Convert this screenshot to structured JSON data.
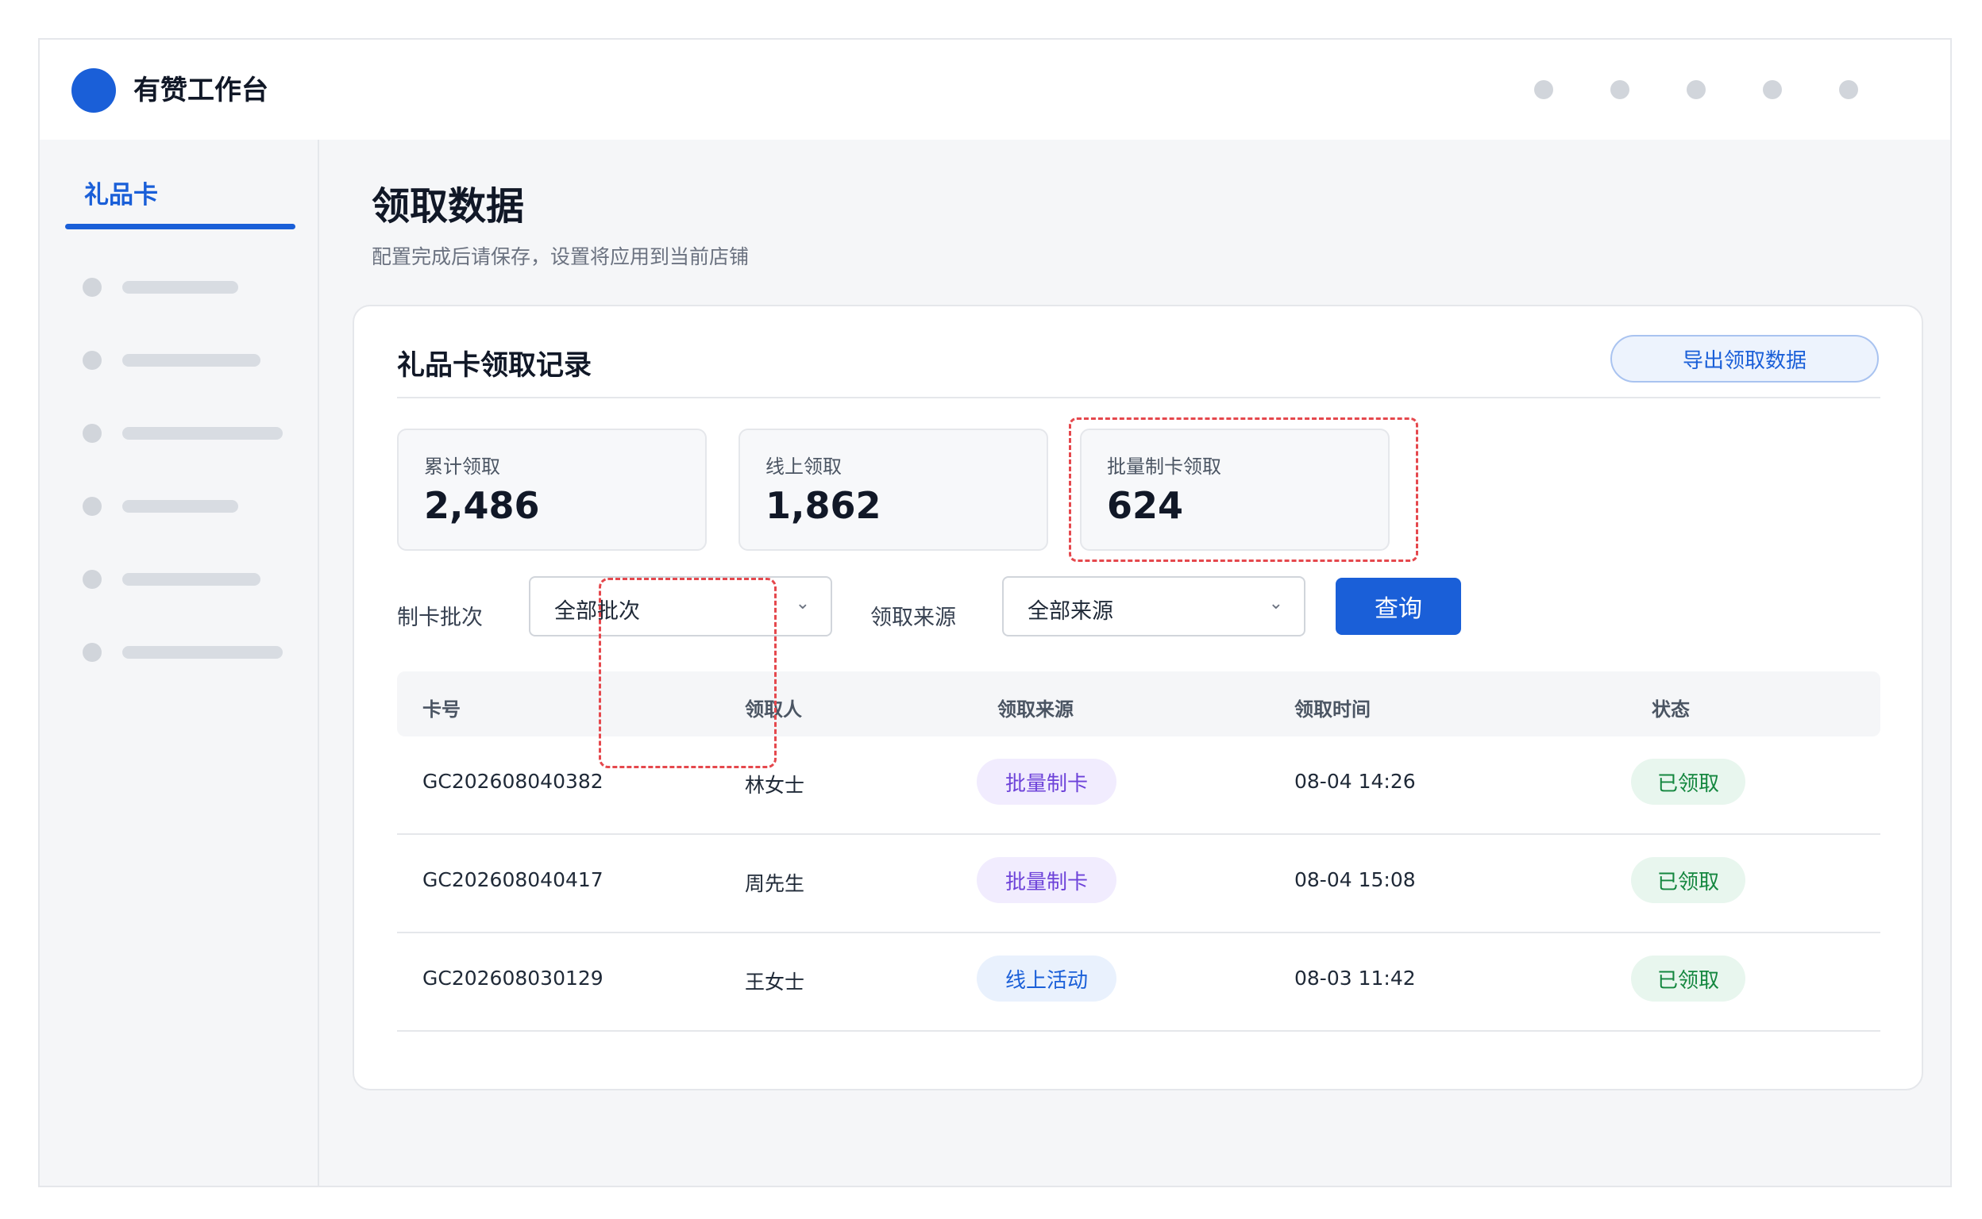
{
  "app": {
    "title": "有赞工作台"
  },
  "sidebar": {
    "active_tab": "礼品卡"
  },
  "page": {
    "title": "领取数据",
    "subtitle": "配置完成后请保存，设置将应用到当前店铺"
  },
  "card": {
    "title": "礼品卡领取记录",
    "export_label": "导出领取数据"
  },
  "stats": [
    {
      "label": "累计领取",
      "value": "2,486"
    },
    {
      "label": "线上领取",
      "value": "1,862"
    },
    {
      "label": "批量制卡领取",
      "value": "624"
    }
  ],
  "filters": {
    "batch_label": "制卡批次",
    "batch_value": "全部批次",
    "source_label": "领取来源",
    "source_value": "全部来源",
    "query_label": "查询"
  },
  "table": {
    "columns": [
      "卡号",
      "领取人",
      "领取来源",
      "领取时间",
      "状态"
    ],
    "rows": [
      {
        "card_no": "GC202608040382",
        "recipient": "林女士",
        "source": "批量制卡",
        "time": "08-04 14:26",
        "status": "已领取"
      },
      {
        "card_no": "GC202608040417",
        "recipient": "周先生",
        "source": "批量制卡",
        "time": "08-04 15:08",
        "status": "已领取"
      },
      {
        "card_no": "GC202608030129",
        "recipient": "王女士",
        "source": "线上活动",
        "time": "08-03 11:42",
        "status": "已领取"
      }
    ]
  },
  "colors": {
    "primary": "#1a5fd8",
    "highlight": "#e5484d",
    "batch_tag": "#6d42d9",
    "success": "#14873f"
  }
}
